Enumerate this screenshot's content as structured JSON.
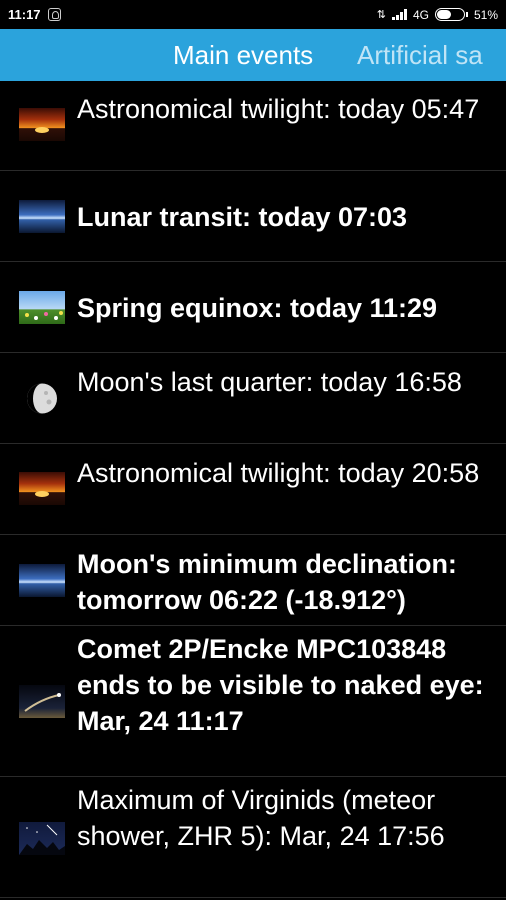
{
  "status_bar": {
    "time": "11:17",
    "network": "4G",
    "battery": "51%",
    "battery_level": 0.51
  },
  "tabs": [
    {
      "label": "Main events",
      "active": true
    },
    {
      "label": "Artificial sa",
      "active": false
    }
  ],
  "events": [
    {
      "icon": "twilight-icon",
      "text": "Astronomical twilight: today 05:47",
      "bold": false
    },
    {
      "icon": "horizon-icon",
      "text": "Lunar transit: today 07:03",
      "bold": true
    },
    {
      "icon": "spring-meadow-icon",
      "text": "Spring equinox: today 11:29",
      "bold": true
    },
    {
      "icon": "moon-phase-icon",
      "text": "Moon's last quarter: today 16:58",
      "bold": false
    },
    {
      "icon": "twilight-icon",
      "text": "Astronomical twilight: today 20:58",
      "bold": false
    },
    {
      "icon": "horizon-icon",
      "text": "Moon's minimum declination: tomorrow 06:22 (-18.912°)",
      "bold": true
    },
    {
      "icon": "comet-icon",
      "text": "Comet 2P/Encke MPC103848 ends to be visible to naked eye: Mar, 24 11:17",
      "bold": true
    },
    {
      "icon": "meteor-shower-icon",
      "text": "Maximum of Virginids (meteor shower, ZHR 5): Mar, 24 17:56",
      "bold": false
    }
  ],
  "colors": {
    "accent": "#2ba3dc",
    "background": "#000000",
    "text": "#ffffff"
  }
}
